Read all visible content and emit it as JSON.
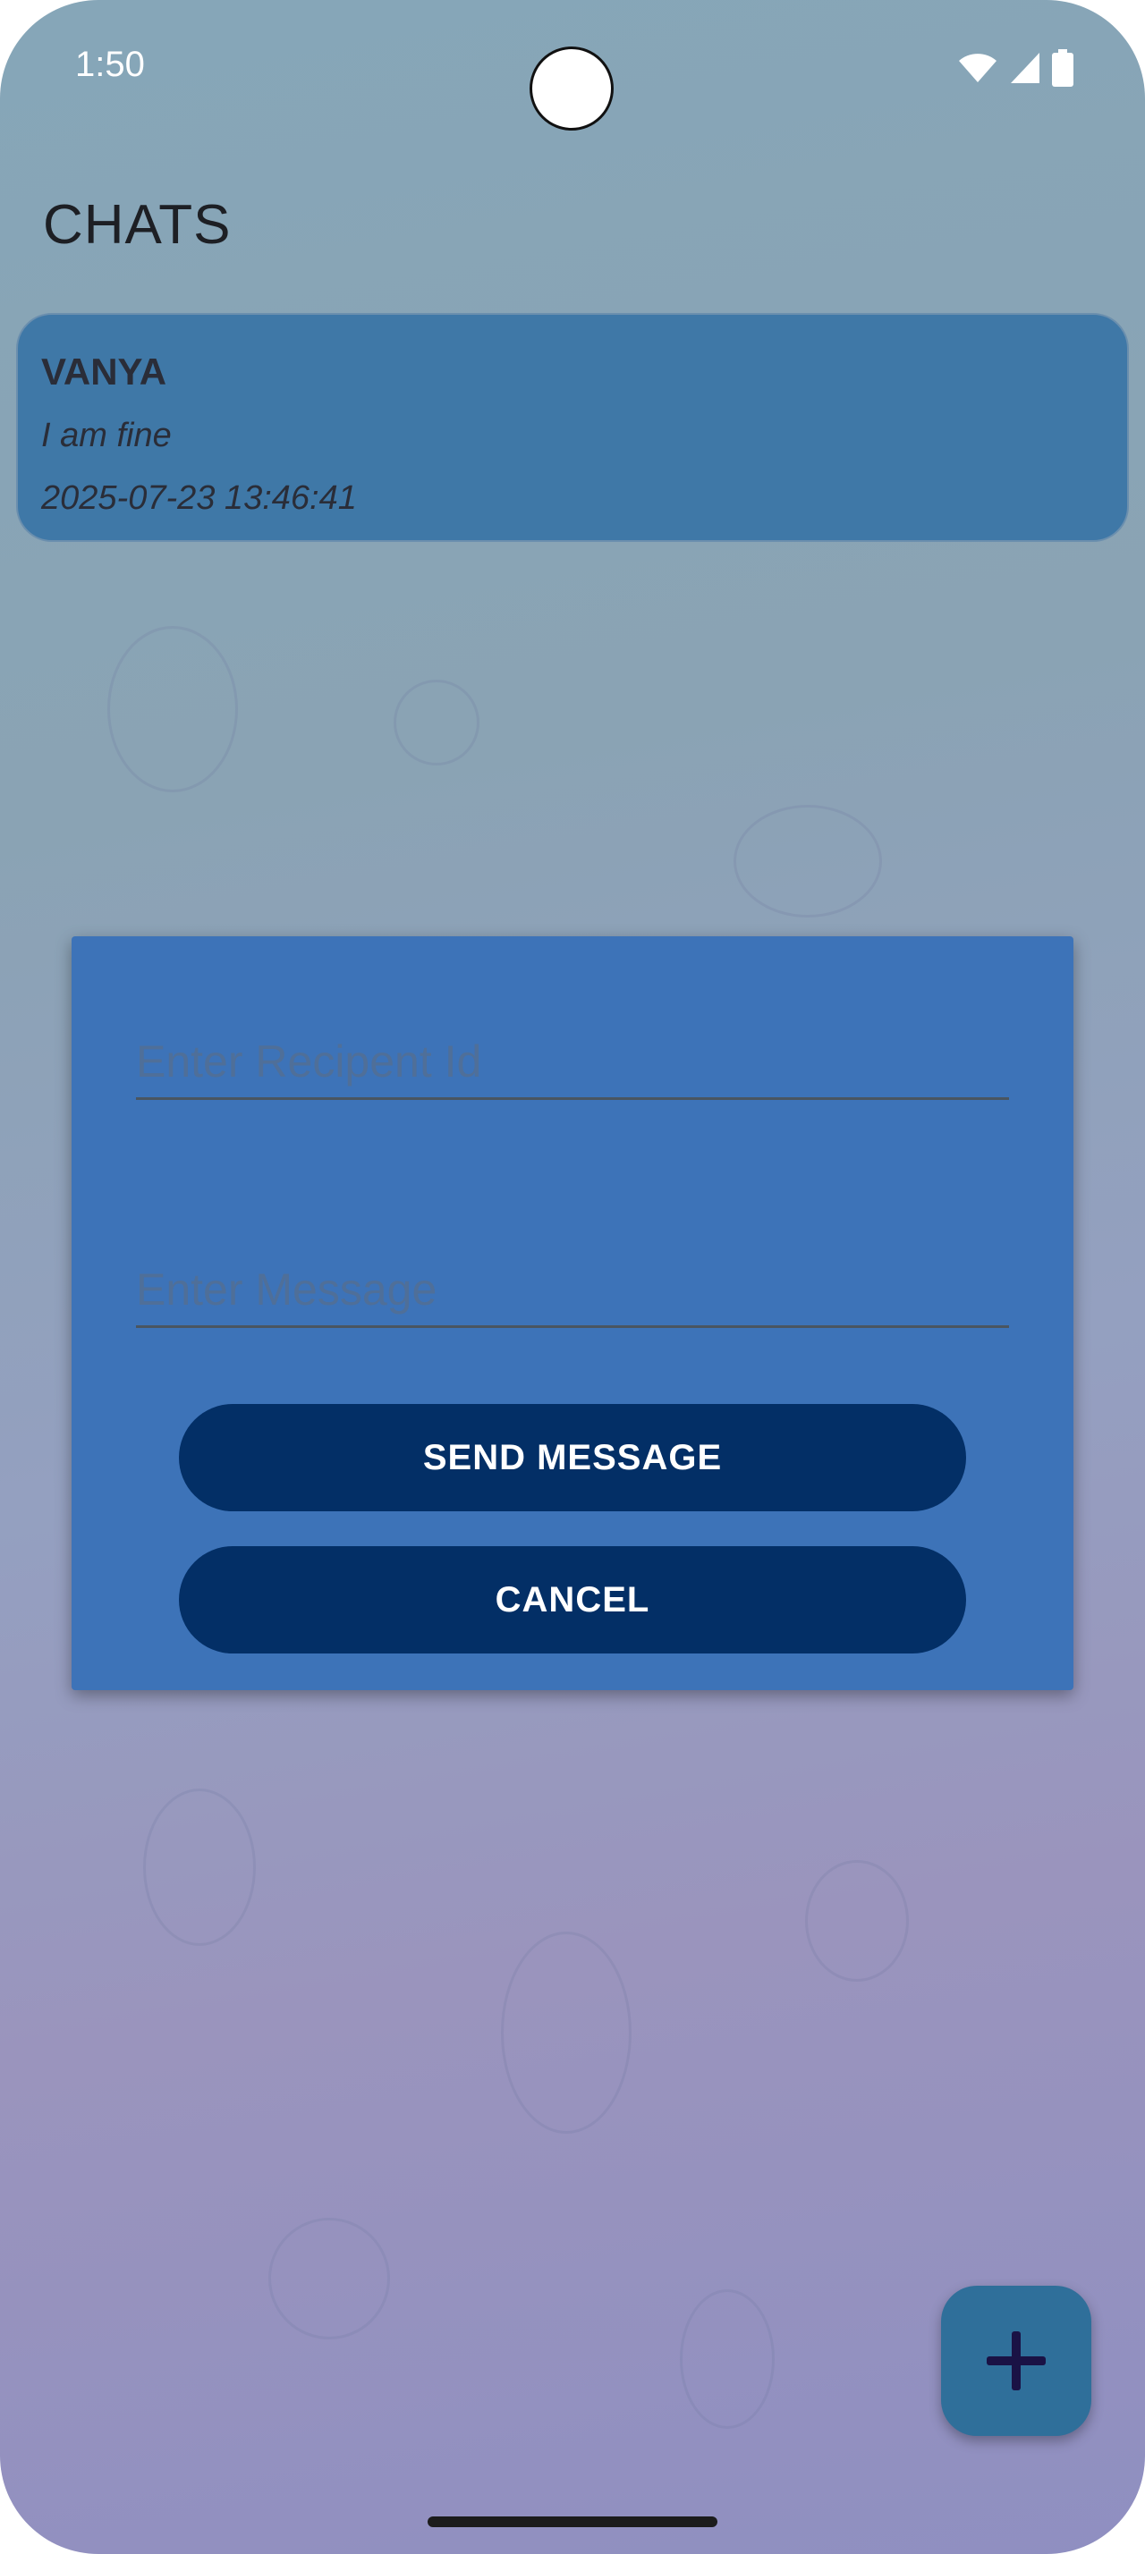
{
  "status_bar": {
    "time": "1:50",
    "icons": [
      "wifi-icon",
      "cellular-signal-icon",
      "battery-icon"
    ]
  },
  "header": {
    "title": "CHATS"
  },
  "chats": [
    {
      "name": "VANYA",
      "last_message": "I am fine",
      "timestamp": "2025-07-23 13:46:41"
    }
  ],
  "dialog": {
    "recipient_placeholder": "Enter Recipent Id",
    "recipient_value": "",
    "message_placeholder": "Enter Message",
    "message_value": "",
    "send_label": "SEND MESSAGE",
    "cancel_label": "CANCEL"
  },
  "fab": {
    "icon": "plus-icon"
  },
  "colors": {
    "card": "#3f78a7",
    "dialog": "#3d73b8",
    "button": "#032f66",
    "fab": "#2f6f9a",
    "fab_icon": "#1a1245"
  }
}
